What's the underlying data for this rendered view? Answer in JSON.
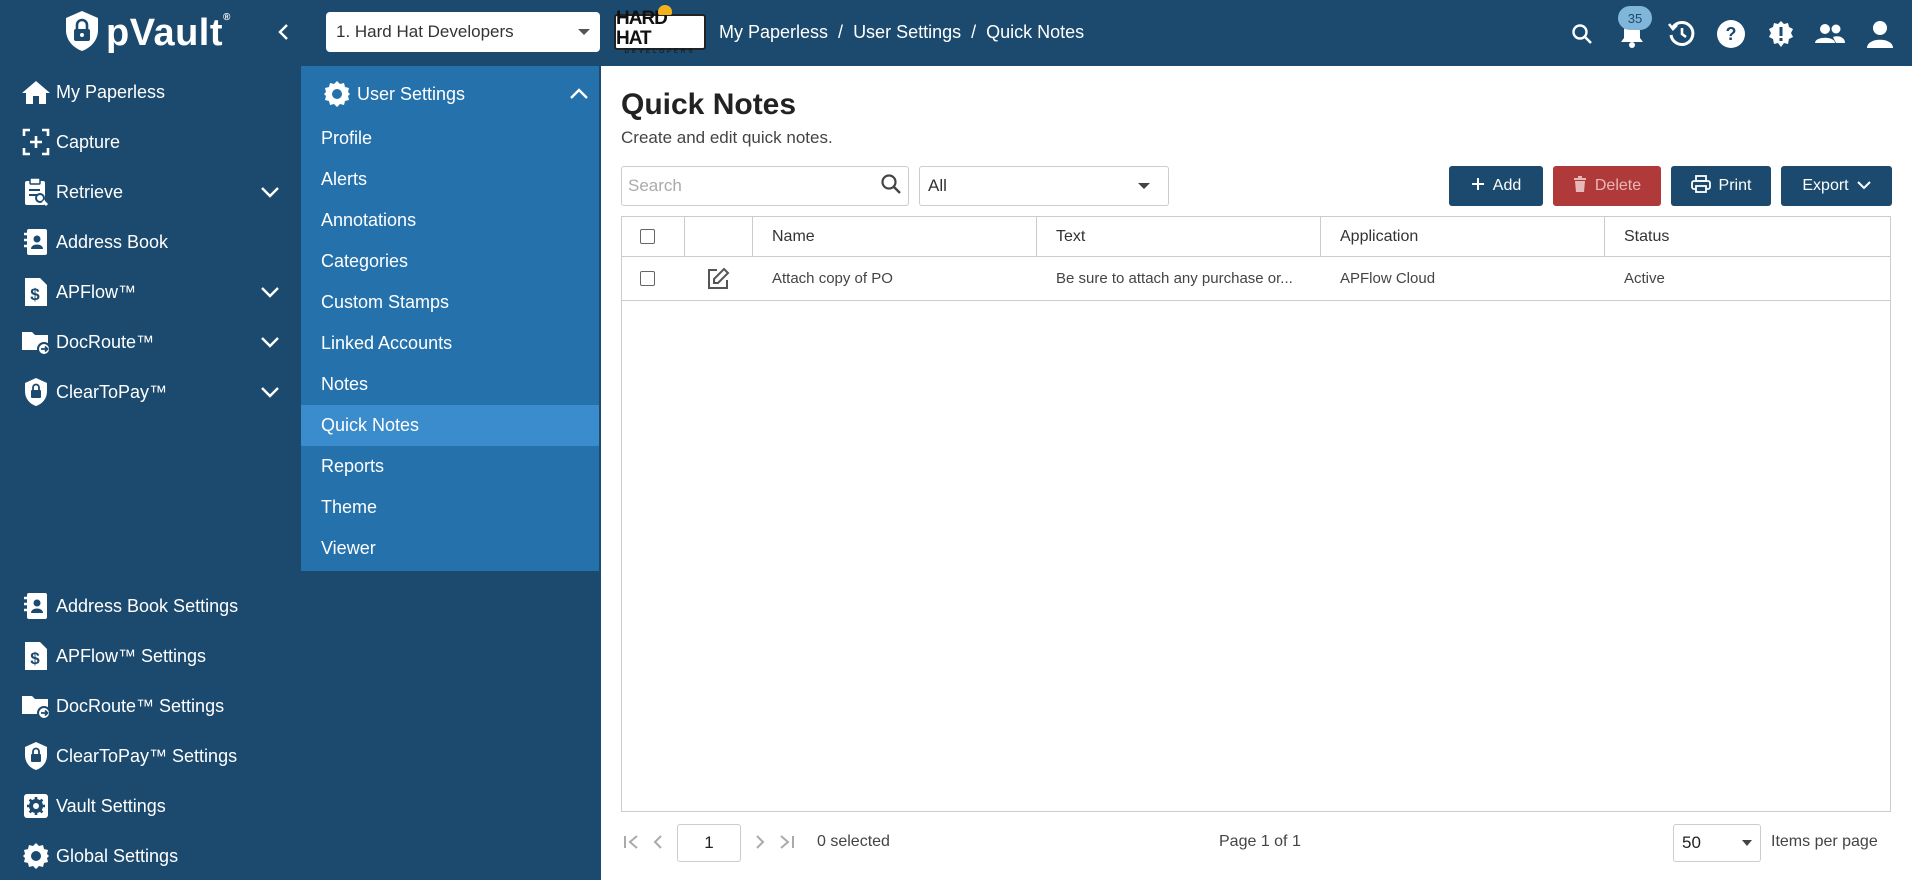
{
  "app": {
    "name": "pVault",
    "trademark": "®"
  },
  "header": {
    "org_select": "1. Hard Hat Developers",
    "org_logo_big": "HARD HAT",
    "org_logo_small": "DEVELOPERS",
    "breadcrumb": [
      "My Paperless",
      "User Settings",
      "Quick Notes"
    ],
    "notification_count": "35"
  },
  "sidebar": {
    "items": [
      {
        "label": "My Paperless",
        "icon": "home-icon",
        "expandable": false
      },
      {
        "label": "Capture",
        "icon": "capture-icon",
        "expandable": false
      },
      {
        "label": "Retrieve",
        "icon": "retrieve-icon",
        "expandable": true
      },
      {
        "label": "Address Book",
        "icon": "address-book-icon",
        "expandable": false
      },
      {
        "label": "APFlow™",
        "icon": "dollar-doc-icon",
        "expandable": true
      },
      {
        "label": "DocRoute™",
        "icon": "folder-route-icon",
        "expandable": true
      },
      {
        "label": "ClearToPay™",
        "icon": "shield-lock-icon",
        "expandable": true
      }
    ],
    "settings": [
      {
        "label": "Address Book Settings",
        "icon": "address-book-icon"
      },
      {
        "label": "APFlow™ Settings",
        "icon": "dollar-doc-icon"
      },
      {
        "label": "DocRoute™ Settings",
        "icon": "folder-route-icon"
      },
      {
        "label": "ClearToPay™ Settings",
        "icon": "shield-lock-icon"
      },
      {
        "label": "Vault Settings",
        "icon": "gear-icon"
      },
      {
        "label": "Global Settings",
        "icon": "gear-icon"
      }
    ]
  },
  "subnav": {
    "header": "User Settings",
    "items": [
      "Profile",
      "Alerts",
      "Annotations",
      "Categories",
      "Custom Stamps",
      "Linked Accounts",
      "Notes",
      "Quick Notes",
      "Reports",
      "Theme",
      "Viewer"
    ],
    "active": "Quick Notes"
  },
  "main": {
    "title": "Quick Notes",
    "subtitle": "Create and edit quick notes.",
    "search_placeholder": "Search",
    "filter_value": "All",
    "buttons": {
      "add": "Add",
      "delete": "Delete",
      "print": "Print",
      "export": "Export"
    },
    "columns": [
      "Name",
      "Text",
      "Application",
      "Status"
    ],
    "rows": [
      {
        "name": "Attach copy of PO",
        "text": "Be sure to attach any purchase or...",
        "application": "APFlow Cloud",
        "status": "Active"
      }
    ],
    "pager": {
      "page": "1",
      "selected": "0 selected",
      "page_info": "Page 1 of 1",
      "per_page": "50",
      "per_page_label": "Items per page"
    }
  },
  "colors": {
    "nav_bg": "#1b4a6e",
    "subnav_bg": "#2471ac",
    "subnav_active": "#3b8ccc",
    "delete": "#b03a3a"
  }
}
